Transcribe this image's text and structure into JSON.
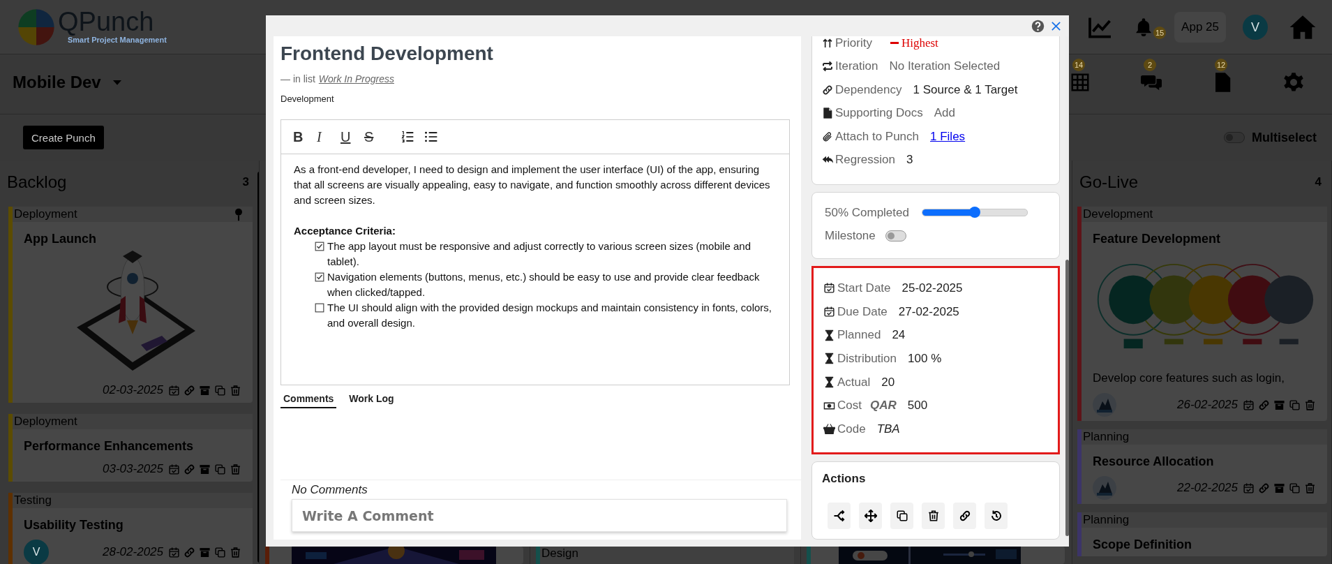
{
  "header": {
    "logo_name": "QPunch",
    "logo_tagline": "Smart Project Management",
    "notifications": "15",
    "app_button": "App 25",
    "avatar": "V"
  },
  "project_bar": {
    "project": "Mobile Dev",
    "counts": [
      "14",
      "2",
      "12"
    ]
  },
  "toolbar": {
    "create_button": "Create Punch",
    "multiselect": {
      "label": "Multiselect",
      "on": false
    }
  },
  "columns": [
    {
      "title": "Backlog",
      "count": "3",
      "cards": [
        {
          "tag": "Deployment",
          "color": "#5c4c00",
          "title": "App Launch",
          "pinned": true,
          "date": "02-03-2025"
        },
        {
          "tag": "Deployment",
          "color": "#5c4c00",
          "title": "Performance Enhancements",
          "pinned": false,
          "date": "03-03-2025"
        },
        {
          "tag": "Testing",
          "color": "#5e3000",
          "title": "Usability Testing",
          "pinned": false,
          "avatar": {
            "kind": "letter",
            "text": "V"
          },
          "date": "28-02-2025"
        }
      ]
    },
    {
      "cards": [
        {
          "color": "#5a1e08"
        }
      ]
    },
    {
      "cards": [
        {
          "tag": "Design",
          "color": "#14504c"
        }
      ]
    },
    {
      "cards": [
        {
          "color": "#14504c"
        }
      ]
    },
    {
      "title": "Go-Live",
      "count": "4",
      "cards": [
        {
          "tag": "Development",
          "color": "#5e1418",
          "title": "Feature Development",
          "pinned": false,
          "description": "Develop core features such as login,",
          "date": "26-02-2025"
        },
        {
          "tag": "Planning",
          "color": "#3c3468",
          "title": "Resource Allocation",
          "pinned": false,
          "date": "22-02-2025"
        },
        {
          "tag": "Planning",
          "color": "#3c3468",
          "title": "Scope Definition",
          "pinned": false
        }
      ]
    }
  ],
  "modal": {
    "title": "Frontend Development",
    "list_prefix": "— in list",
    "list_name": "Work In Progress",
    "category": "Development",
    "format_buttons": [
      "B",
      "I",
      "U",
      "S"
    ],
    "editor": {
      "paragraph": "As a front-end developer, I need to design and implement the user interface (UI) of the app, ensuring that all screens are visually appealing, easy to navigate, and function smoothly across different devices and screen sizes.",
      "heading": "Acceptance Criteria:",
      "criteria": [
        {
          "text": "The app layout must be responsive and adjust correctly to various screen sizes (mobile and tablet).",
          "checked": true
        },
        {
          "text": "Navigation elements (buttons, menus, etc.) should be easy to use and provide clear feedback when clicked/tapped.",
          "checked": true
        },
        {
          "text": "The UI should align with the provided design mockups and maintain consistency in fonts, colors, and overall design.",
          "checked": false
        }
      ]
    },
    "tabs": [
      {
        "label": "Comments",
        "selected": true
      },
      {
        "label": "Work Log",
        "selected": false
      }
    ],
    "empty_comments": "No Comments",
    "comment_field": {
      "placeholder": "Write A Comment"
    },
    "details": [
      {
        "label": "Priority",
        "value": "Highest",
        "kind": "priority"
      },
      {
        "label": "Iteration",
        "value": "No Iteration Selected",
        "kind": "muted"
      },
      {
        "label": "Dependency",
        "value": "1 Source & 1 Target",
        "kind": "text"
      },
      {
        "label": "Supporting Docs",
        "value": "Add",
        "kind": "muted"
      },
      {
        "label": "Attach to Punch",
        "value": "1 Files",
        "kind": "link"
      },
      {
        "label": "Regression",
        "value": "3",
        "kind": "text"
      }
    ],
    "progress": {
      "label": "50% Completed",
      "level": 0.5
    },
    "milestone": {
      "label": "Milestone",
      "on": false
    },
    "schedule": {
      "highlighted": true,
      "rows": [
        {
          "label": "Start Date",
          "value": "25-02-2025",
          "kind": "text"
        },
        {
          "label": "Due Date",
          "value": "27-02-2025",
          "kind": "text"
        },
        {
          "label": "Planned",
          "value": "24",
          "kind": "text"
        },
        {
          "label": "Distribution",
          "value": "100 %",
          "kind": "text"
        },
        {
          "label": "Actual",
          "value": "20",
          "kind": "text"
        },
        {
          "label": "Cost",
          "unit": "QAR",
          "value": "500",
          "kind": "text"
        },
        {
          "label": "Code",
          "value": "TBA",
          "kind": "italic"
        }
      ]
    },
    "actions": {
      "title": "Actions"
    }
  }
}
